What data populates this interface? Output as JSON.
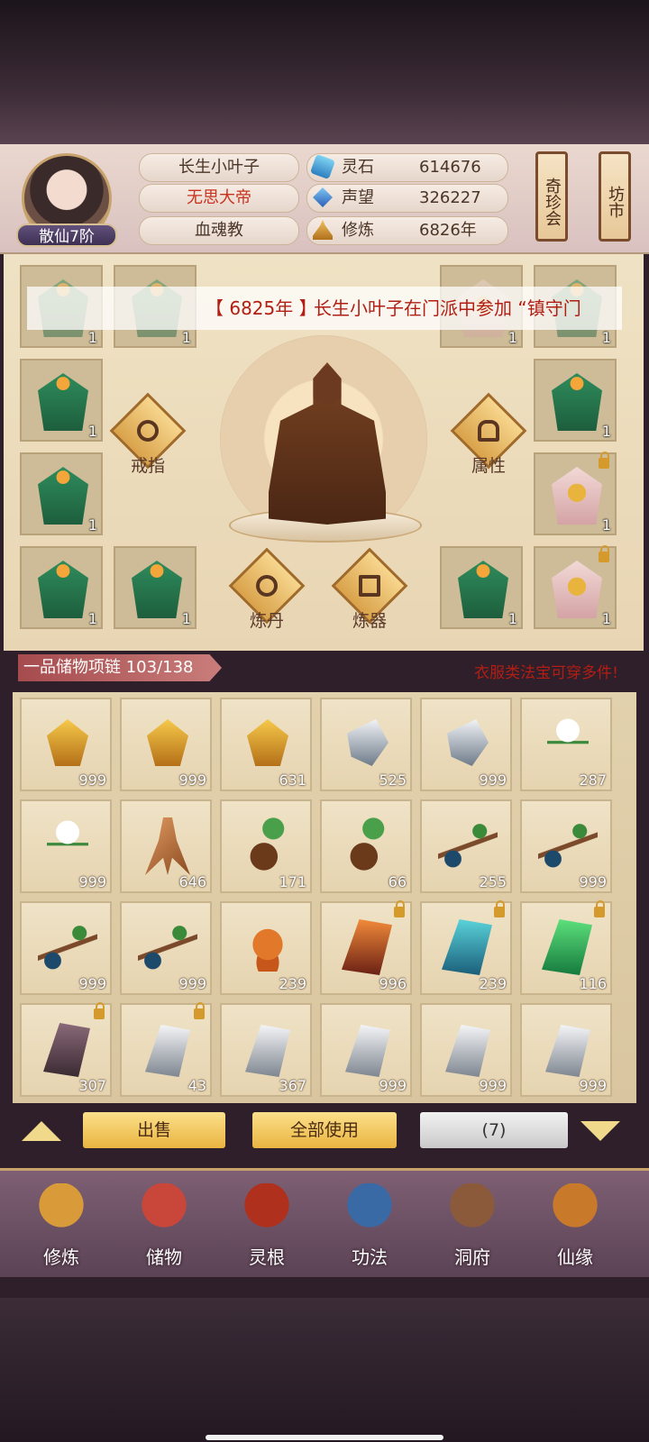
{
  "header": {
    "player_name": "长生小叶子",
    "title": "无思大帝",
    "sect": "血魂教",
    "rank": "散仙7阶",
    "stats": [
      {
        "label": "灵石",
        "value": "614676",
        "icon": "spirit-stone-icon"
      },
      {
        "label": "声望",
        "value": "326227",
        "icon": "prestige-icon"
      },
      {
        "label": "修炼",
        "value": "6826年",
        "icon": "meditation-icon"
      }
    ],
    "side_buttons": [
      "奇珍会",
      "坊市"
    ]
  },
  "ticker": {
    "year": "【 6825年 】",
    "text": "长生小叶子在门派中参加 “镇守门"
  },
  "equipment": {
    "left_slots": [
      "1",
      "1",
      "1",
      "1",
      "1",
      "1"
    ],
    "right_slots": [
      "1",
      "1",
      "1",
      "1",
      "1",
      "1"
    ],
    "actions": {
      "ring": "戒指",
      "attributes": "属性",
      "alchemy": "炼丹",
      "forging": "炼器"
    }
  },
  "bag": {
    "title": "一品储物项链 103/138",
    "hint": "衣服类法宝可穿多件!",
    "items": [
      {
        "icon": "gold-ore-icon",
        "count": "999",
        "locked": false,
        "kind": "gold"
      },
      {
        "icon": "gold-ore-icon",
        "count": "999",
        "locked": false,
        "kind": "gold"
      },
      {
        "icon": "gold-ore-icon",
        "count": "631",
        "locked": false,
        "kind": "gold"
      },
      {
        "icon": "iron-ore-icon",
        "count": "525",
        "locked": false,
        "kind": "iron"
      },
      {
        "icon": "iron-ore-icon",
        "count": "999",
        "locked": false,
        "kind": "iron"
      },
      {
        "icon": "white-flower-icon",
        "count": "287",
        "locked": false,
        "kind": "flower"
      },
      {
        "icon": "white-flower-icon",
        "count": "999",
        "locked": false,
        "kind": "flower"
      },
      {
        "icon": "ginseng-root-icon",
        "count": "646",
        "locked": false,
        "kind": "root"
      },
      {
        "icon": "herb-root-icon",
        "count": "171",
        "locked": false,
        "kind": "herb"
      },
      {
        "icon": "red-herb-icon",
        "count": "66",
        "locked": false,
        "kind": "herb"
      },
      {
        "icon": "berry-branch-icon",
        "count": "255",
        "locked": false,
        "kind": "branch"
      },
      {
        "icon": "berry-branch-icon",
        "count": "999",
        "locked": false,
        "kind": "branch"
      },
      {
        "icon": "berry-branch-icon",
        "count": "999",
        "locked": false,
        "kind": "branch"
      },
      {
        "icon": "berry-branch-icon",
        "count": "999",
        "locked": false,
        "kind": "branch"
      },
      {
        "icon": "fire-worm-icon",
        "count": "239",
        "locked": false,
        "kind": "worm"
      },
      {
        "icon": "red-crystal-icon",
        "count": "996",
        "locked": true,
        "kind": "red"
      },
      {
        "icon": "blue-crystal-icon",
        "count": "239",
        "locked": true,
        "kind": "blue"
      },
      {
        "icon": "green-crystal-icon",
        "count": "116",
        "locked": true,
        "kind": "green"
      },
      {
        "icon": "purple-stone-icon",
        "count": "307",
        "locked": true,
        "kind": "purple"
      },
      {
        "icon": "silver-stone-icon",
        "count": "43",
        "locked": true,
        "kind": "silver"
      },
      {
        "icon": "silver-stone-icon",
        "count": "367",
        "locked": false,
        "kind": "silver"
      },
      {
        "icon": "silver-stone-icon",
        "count": "999",
        "locked": false,
        "kind": "silver"
      },
      {
        "icon": "silver-stone-icon",
        "count": "999",
        "locked": false,
        "kind": "silver"
      },
      {
        "icon": "silver-stone-icon",
        "count": "999",
        "locked": false,
        "kind": "silver"
      }
    ]
  },
  "actions": {
    "sell": "出售",
    "use_all": "全部使用",
    "selected_count": "(7)"
  },
  "nav": [
    {
      "label": "修炼",
      "icon": "cultivation-icon",
      "color": "#d99a3a"
    },
    {
      "label": "储物",
      "icon": "storage-bag-icon",
      "color": "#c9473a"
    },
    {
      "label": "灵根",
      "icon": "spirit-root-icon",
      "color": "#b0301e"
    },
    {
      "label": "功法",
      "icon": "technique-book-icon",
      "color": "#3a6aa6"
    },
    {
      "label": "洞府",
      "icon": "cave-dwelling-icon",
      "color": "#8a5a3a"
    },
    {
      "label": "仙缘",
      "icon": "immortal-fate-icon",
      "color": "#c87a2a"
    }
  ]
}
